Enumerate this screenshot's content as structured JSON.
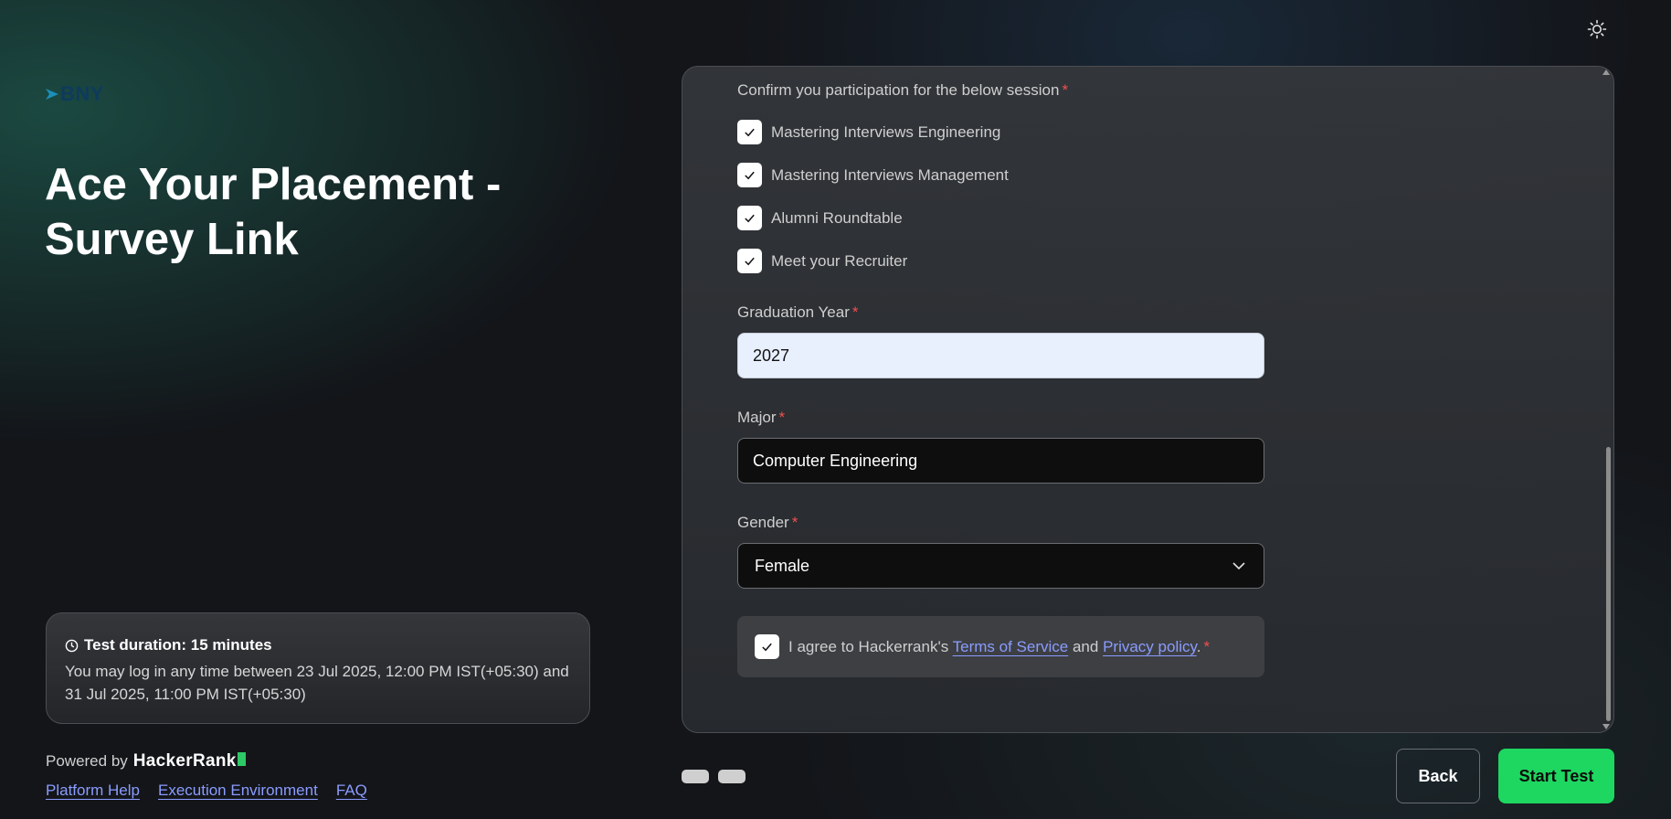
{
  "header": {
    "logo_text": "BNY",
    "title": "Ace Your Placement - Survey Link",
    "theme_toggle_icon": "sun-icon"
  },
  "info": {
    "duration_label": "Test duration: 15 minutes",
    "window_text": "You may log in any time between 23 Jul 2025, 12:00 PM IST(+05:30) and 31 Jul 2025, 11:00 PM IST(+05:30)"
  },
  "footer": {
    "powered_by": "Powered by",
    "brand": "HackerRank",
    "links": [
      "Platform Help",
      "Execution Environment",
      "FAQ"
    ]
  },
  "form": {
    "sessions_label": "Confirm you participation for the below session",
    "sessions": [
      {
        "label": "Mastering Interviews Engineering",
        "checked": true
      },
      {
        "label": "Mastering Interviews Management",
        "checked": true
      },
      {
        "label": "Alumni Roundtable",
        "checked": true
      },
      {
        "label": "Meet your Recruiter",
        "checked": true
      }
    ],
    "graduation_year": {
      "label": "Graduation Year",
      "value": "2027"
    },
    "major": {
      "label": "Major",
      "value": "Computer Engineering"
    },
    "gender": {
      "label": "Gender",
      "value": "Female"
    },
    "agree": {
      "prefix": "I agree to Hackerrank's",
      "terms_link": "Terms of Service",
      "and": "and",
      "privacy_link": "Privacy policy",
      "suffix": ".",
      "checked": true
    },
    "required_marker": "*"
  },
  "actions": {
    "back_label": "Back",
    "start_label": "Start Test"
  },
  "colors": {
    "accent_green": "#1ed760",
    "link_blue": "#8a9cff",
    "required_red": "#f05050"
  }
}
